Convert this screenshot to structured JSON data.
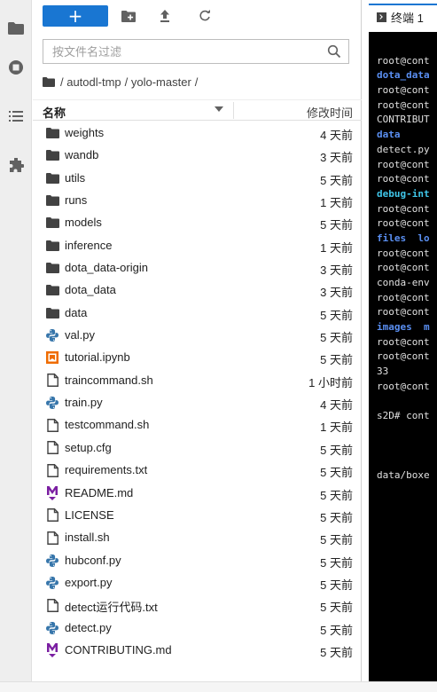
{
  "toolbar": {
    "new_label": "+"
  },
  "filter": {
    "placeholder": "按文件名过滤"
  },
  "breadcrumb": {
    "parts": [
      "/ autodl-tmp",
      "/ yolo-master",
      "/"
    ]
  },
  "list_header": {
    "name": "名称",
    "modified": "修改时间"
  },
  "files": [
    {
      "name": "weights",
      "modified": "4 天前",
      "type": "folder"
    },
    {
      "name": "wandb",
      "modified": "3 天前",
      "type": "folder"
    },
    {
      "name": "utils",
      "modified": "5 天前",
      "type": "folder"
    },
    {
      "name": "runs",
      "modified": "1 天前",
      "type": "folder"
    },
    {
      "name": "models",
      "modified": "5 天前",
      "type": "folder"
    },
    {
      "name": "inference",
      "modified": "1 天前",
      "type": "folder"
    },
    {
      "name": "dota_data-origin",
      "modified": "3 天前",
      "type": "folder"
    },
    {
      "name": "dota_data",
      "modified": "3 天前",
      "type": "folder"
    },
    {
      "name": "data",
      "modified": "5 天前",
      "type": "folder"
    },
    {
      "name": "val.py",
      "modified": "5 天前",
      "type": "python"
    },
    {
      "name": "tutorial.ipynb",
      "modified": "5 天前",
      "type": "notebook"
    },
    {
      "name": "traincommand.sh",
      "modified": "1 小时前",
      "type": "file"
    },
    {
      "name": "train.py",
      "modified": "4 天前",
      "type": "python"
    },
    {
      "name": "testcommand.sh",
      "modified": "1 天前",
      "type": "file"
    },
    {
      "name": "setup.cfg",
      "modified": "5 天前",
      "type": "file"
    },
    {
      "name": "requirements.txt",
      "modified": "5 天前",
      "type": "file"
    },
    {
      "name": "README.md",
      "modified": "5 天前",
      "type": "markdown"
    },
    {
      "name": "LICENSE",
      "modified": "5 天前",
      "type": "file"
    },
    {
      "name": "install.sh",
      "modified": "5 天前",
      "type": "file"
    },
    {
      "name": "hubconf.py",
      "modified": "5 天前",
      "type": "python"
    },
    {
      "name": "export.py",
      "modified": "5 天前",
      "type": "python"
    },
    {
      "name": "detect运行代码.txt",
      "modified": "5 天前",
      "type": "file"
    },
    {
      "name": "detect.py",
      "modified": "5 天前",
      "type": "python"
    },
    {
      "name": "CONTRIBUTING.md",
      "modified": "5 天前",
      "type": "markdown"
    }
  ],
  "terminal": {
    "tab_label": "终端 1",
    "lines": [
      {
        "text": "",
        "style": ""
      },
      {
        "text": "root@cont",
        "style": ""
      },
      {
        "text": "dota_data",
        "style": "dir"
      },
      {
        "text": "root@cont",
        "style": ""
      },
      {
        "text": "root@cont",
        "style": ""
      },
      {
        "text": "CONTRIBUT",
        "style": ""
      },
      {
        "text": "data",
        "style": "dir"
      },
      {
        "text": "detect.py",
        "style": ""
      },
      {
        "text": "root@cont",
        "style": ""
      },
      {
        "text": "root@cont",
        "style": ""
      },
      {
        "text": "debug-int",
        "style": "cyan"
      },
      {
        "text": "root@cont",
        "style": ""
      },
      {
        "text": "root@cont",
        "style": ""
      },
      {
        "text": "files  lo",
        "style": "dir"
      },
      {
        "text": "root@cont",
        "style": ""
      },
      {
        "text": "root@cont",
        "style": ""
      },
      {
        "text": "conda-env",
        "style": ""
      },
      {
        "text": "root@cont",
        "style": ""
      },
      {
        "text": "root@cont",
        "style": ""
      },
      {
        "text": "images  m",
        "style": "dir"
      },
      {
        "text": "root@cont",
        "style": ""
      },
      {
        "text": "root@cont",
        "style": ""
      },
      {
        "text": "33",
        "style": ""
      },
      {
        "text": "root@cont",
        "style": ""
      },
      {
        "text": "",
        "style": ""
      },
      {
        "text": "s2D# cont",
        "style": ""
      },
      {
        "text": "",
        "style": ""
      },
      {
        "text": "",
        "style": ""
      },
      {
        "text": "",
        "style": ""
      },
      {
        "text": "data/boxe",
        "style": ""
      }
    ]
  }
}
